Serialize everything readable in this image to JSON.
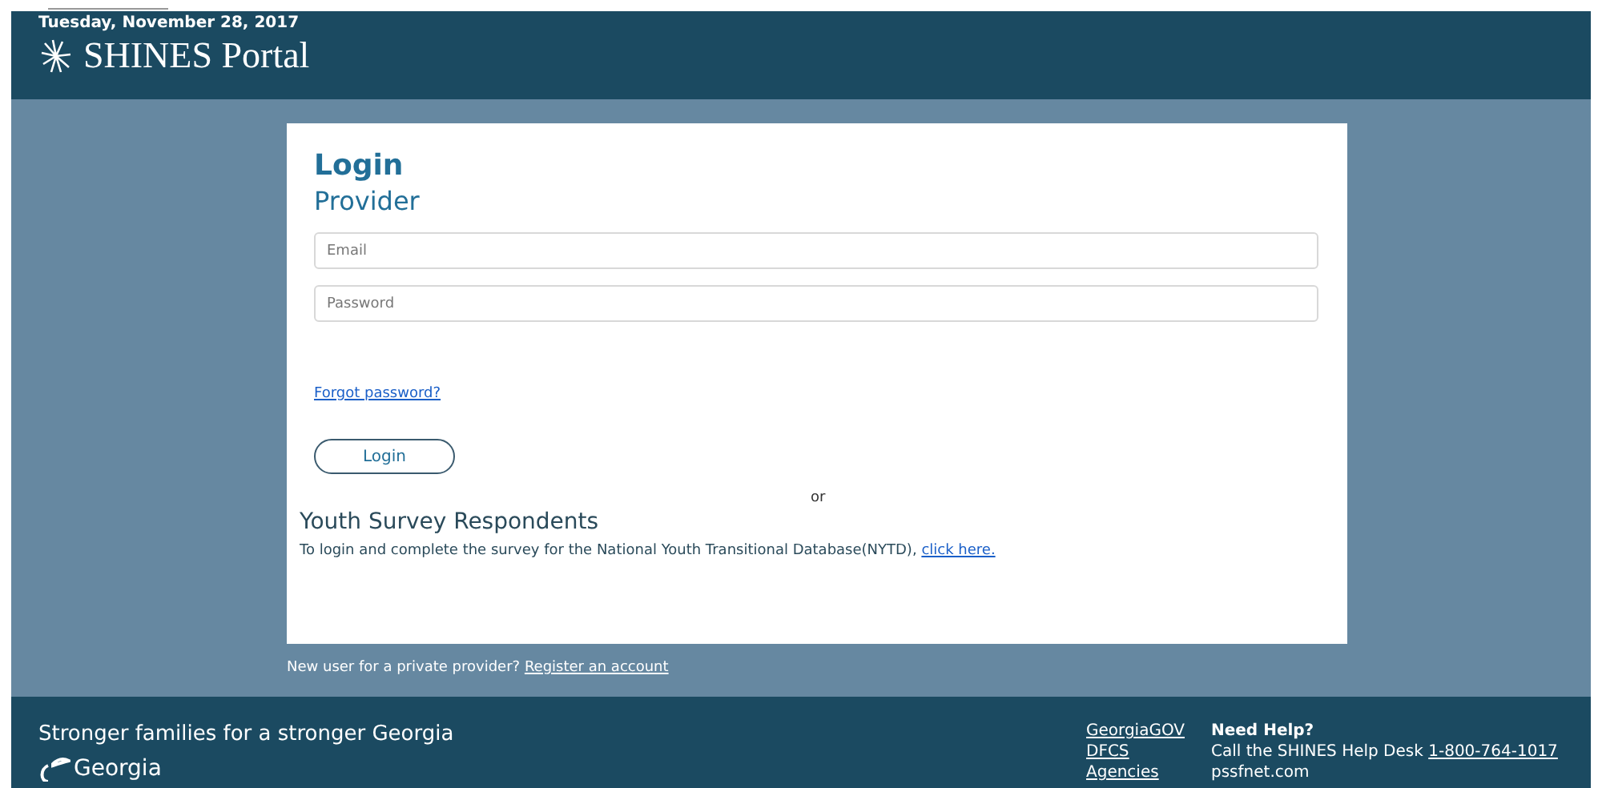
{
  "header": {
    "date": "Tuesday, November 28, 2017",
    "title": "SHINES Portal"
  },
  "login": {
    "heading": "Login",
    "subheading": "Provider",
    "fields": [
      {
        "placeholder": "Email"
      },
      {
        "placeholder": "Password"
      }
    ],
    "forgot_link": "Forgot password?",
    "button": "Login",
    "separator": "or",
    "youth_heading": "Youth Survey Respondents",
    "youth_text": "To login and complete the survey for the National Youth Transitional Database(NYTD),",
    "youth_link": "click here."
  },
  "register": {
    "text": "New user for a private provider?",
    "link": "Register an account"
  },
  "footer": {
    "tagline": "Stronger families for a stronger Georgia",
    "logo_text": "Georgia",
    "links": [
      "GeorgiaGOV",
      "DFCS",
      "Agencies"
    ],
    "help_heading": "Need Help?",
    "help_text": "Call the SHINES Help Desk",
    "help_phone": "1-800-764-1017",
    "help_site": "pssfnet.com"
  }
}
